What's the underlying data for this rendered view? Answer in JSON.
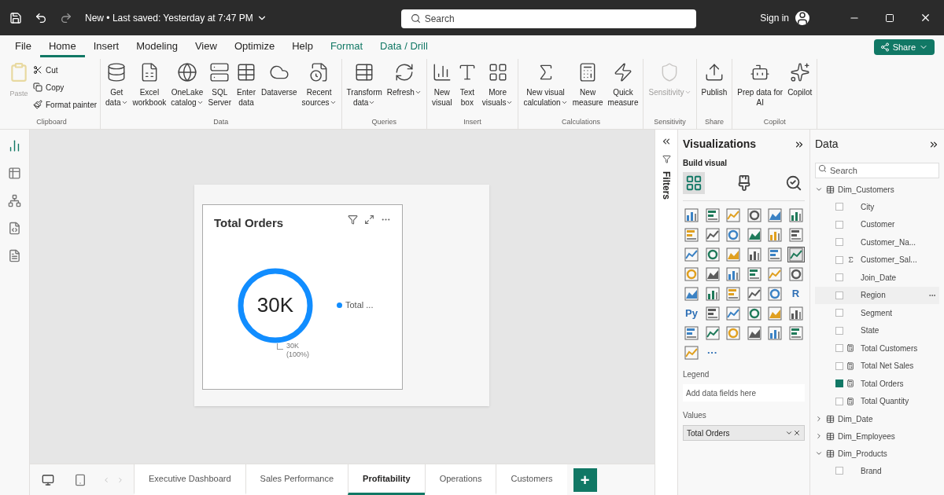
{
  "title_bar": {
    "title": "New • Last saved: Yesterday at 7:47 PM",
    "search": {
      "placeholder": "Search"
    },
    "sign_in": "Sign in"
  },
  "menu_tabs": [
    {
      "label": "File",
      "selected": false,
      "kind": "normal"
    },
    {
      "label": "Home",
      "selected": true,
      "kind": "normal"
    },
    {
      "label": "Insert",
      "selected": false,
      "kind": "normal"
    },
    {
      "label": "Modeling",
      "selected": false,
      "kind": "normal"
    },
    {
      "label": "View",
      "selected": false,
      "kind": "normal"
    },
    {
      "label": "Optimize",
      "selected": false,
      "kind": "normal"
    },
    {
      "label": "Help",
      "selected": false,
      "kind": "normal"
    },
    {
      "label": "Format",
      "selected": false,
      "kind": "contextual"
    },
    {
      "label": "Data / Drill",
      "selected": false,
      "kind": "contextual"
    }
  ],
  "share_button": "Share",
  "ribbon": [
    {
      "group": "Clipboard",
      "kind": "clipboard",
      "buttons": [
        {
          "lines": [
            "Paste"
          ],
          "disabled": true,
          "dropdown": false
        },
        {
          "lines": [
            "Cut"
          ],
          "disabled": false,
          "dropdown": false
        },
        {
          "lines": [
            "Copy"
          ],
          "disabled": false,
          "dropdown": false
        },
        {
          "lines": [
            "Format painter"
          ],
          "disabled": false,
          "dropdown": false
        }
      ]
    },
    {
      "group": "Data",
      "kind": "large",
      "buttons": [
        {
          "lines": [
            "Get",
            "data"
          ],
          "disabled": false,
          "dropdown": true
        },
        {
          "lines": [
            "Excel",
            "workbook"
          ],
          "disabled": false,
          "dropdown": false
        },
        {
          "lines": [
            "OneLake",
            "catalog"
          ],
          "disabled": false,
          "dropdown": true
        },
        {
          "lines": [
            "SQL",
            "Server"
          ],
          "disabled": false,
          "dropdown": false
        },
        {
          "lines": [
            "Enter",
            "data"
          ],
          "disabled": false,
          "dropdown": false
        },
        {
          "lines": [
            "Dataverse"
          ],
          "disabled": false,
          "dropdown": false
        },
        {
          "lines": [
            "Recent",
            "sources"
          ],
          "disabled": false,
          "dropdown": true
        }
      ]
    },
    {
      "group": "Queries",
      "kind": "large",
      "buttons": [
        {
          "lines": [
            "Transform",
            "data"
          ],
          "disabled": false,
          "dropdown": true
        },
        {
          "lines": [
            "Refresh"
          ],
          "disabled": false,
          "dropdown": true
        }
      ]
    },
    {
      "group": "Insert",
      "kind": "large",
      "buttons": [
        {
          "lines": [
            "New",
            "visual"
          ],
          "disabled": false,
          "dropdown": false
        },
        {
          "lines": [
            "Text",
            "box"
          ],
          "disabled": false,
          "dropdown": false
        },
        {
          "lines": [
            "More",
            "visuals"
          ],
          "disabled": false,
          "dropdown": true
        }
      ]
    },
    {
      "group": "Calculations",
      "kind": "large",
      "buttons": [
        {
          "lines": [
            "New visual",
            "calculation"
          ],
          "disabled": false,
          "dropdown": true
        },
        {
          "lines": [
            "New",
            "measure"
          ],
          "disabled": false,
          "dropdown": false
        },
        {
          "lines": [
            "Quick",
            "measure"
          ],
          "disabled": false,
          "dropdown": false
        }
      ]
    },
    {
      "group": "Sensitivity",
      "kind": "large",
      "buttons": [
        {
          "lines": [
            "Sensitivity"
          ],
          "disabled": true,
          "dropdown": true
        }
      ]
    },
    {
      "group": "Share",
      "kind": "large",
      "buttons": [
        {
          "lines": [
            "Publish"
          ],
          "disabled": false,
          "dropdown": false
        }
      ]
    },
    {
      "group": "Copilot",
      "kind": "large",
      "buttons": [
        {
          "lines": [
            "Prep data for",
            "AI"
          ],
          "disabled": false,
          "dropdown": false
        },
        {
          "lines": [
            "Copilot"
          ],
          "disabled": false,
          "dropdown": false
        }
      ]
    }
  ],
  "left_rail": [
    {
      "selected": true
    },
    {
      "selected": false
    },
    {
      "selected": false
    },
    {
      "selected": false
    },
    {
      "selected": false
    }
  ],
  "visual": {
    "title": "Total Orders",
    "center_value": "30K",
    "data_label": "30K",
    "data_label_share": "(100%)",
    "legend": [
      {
        "label": "Total ...",
        "color": "#118dff"
      }
    ]
  },
  "page_tabs": [
    {
      "label": "Executive Dashboard",
      "selected": false
    },
    {
      "label": "Sales Performance",
      "selected": false
    },
    {
      "label": "Profitability",
      "selected": true
    },
    {
      "label": "Operations",
      "selected": false
    },
    {
      "label": "Customers",
      "selected": false
    }
  ],
  "add_page": "+",
  "filters": {
    "title": "Filters"
  },
  "visualizations": {
    "title": "Visualizations",
    "subtitle": "Build visual",
    "build_tabs": [
      {
        "selected": true
      },
      {
        "selected": false
      },
      {
        "selected": false
      }
    ],
    "gallery": [
      {
        "kind": "icon",
        "selected": false
      },
      {
        "kind": "icon",
        "selected": false
      },
      {
        "kind": "icon",
        "selected": false
      },
      {
        "kind": "icon",
        "selected": false
      },
      {
        "kind": "icon",
        "selected": false
      },
      {
        "kind": "icon",
        "selected": false
      },
      {
        "kind": "icon",
        "selected": false
      },
      {
        "kind": "icon",
        "selected": false
      },
      {
        "kind": "icon",
        "selected": false
      },
      {
        "kind": "icon",
        "selected": false
      },
      {
        "kind": "icon",
        "selected": false
      },
      {
        "kind": "icon",
        "selected": false
      },
      {
        "kind": "icon",
        "selected": false
      },
      {
        "kind": "icon",
        "selected": false
      },
      {
        "kind": "icon",
        "selected": false
      },
      {
        "kind": "icon",
        "selected": false
      },
      {
        "kind": "icon",
        "selected": false
      },
      {
        "kind": "icon",
        "selected": true
      },
      {
        "kind": "icon",
        "selected": false
      },
      {
        "kind": "icon",
        "selected": false
      },
      {
        "kind": "icon",
        "selected": false
      },
      {
        "kind": "icon",
        "selected": false
      },
      {
        "kind": "icon",
        "selected": false
      },
      {
        "kind": "icon",
        "selected": false
      },
      {
        "kind": "icon",
        "selected": false
      },
      {
        "kind": "icon",
        "selected": false
      },
      {
        "kind": "icon",
        "selected": false
      },
      {
        "kind": "icon",
        "selected": false
      },
      {
        "kind": "icon",
        "selected": false
      },
      {
        "kind": "text",
        "text": "R",
        "selected": false
      },
      {
        "kind": "text",
        "text": "Py",
        "selected": false
      },
      {
        "kind": "icon",
        "selected": false
      },
      {
        "kind": "icon",
        "selected": false
      },
      {
        "kind": "icon",
        "selected": false
      },
      {
        "kind": "icon",
        "selected": false
      },
      {
        "kind": "icon",
        "selected": false
      },
      {
        "kind": "icon",
        "selected": false
      },
      {
        "kind": "icon",
        "selected": false
      },
      {
        "kind": "icon",
        "selected": false
      },
      {
        "kind": "icon",
        "selected": false
      },
      {
        "kind": "icon",
        "selected": false
      },
      {
        "kind": "icon",
        "selected": false
      },
      {
        "kind": "icon",
        "selected": false
      },
      {
        "kind": "text",
        "text": "···",
        "selected": false
      }
    ],
    "wells": [
      {
        "label": "Legend",
        "placeholder": "Add data fields here"
      },
      {
        "label": "Values",
        "value": "Total Orders"
      }
    ]
  },
  "data": {
    "title": "Data",
    "search": {
      "placeholder": "Search"
    },
    "tables": [
      {
        "name": "Dim_Customers",
        "expanded": true,
        "children": [
          {
            "label": "City",
            "kind": "column",
            "checked": false,
            "hovered": false
          },
          {
            "label": "Customer",
            "kind": "column",
            "checked": false,
            "hovered": false
          },
          {
            "label": "Customer_Na...",
            "kind": "column",
            "checked": false,
            "hovered": false
          },
          {
            "label": "Customer_Sal...",
            "kind": "sum",
            "checked": false,
            "hovered": false
          },
          {
            "label": "Join_Date",
            "kind": "column",
            "checked": false,
            "hovered": false
          },
          {
            "label": "Region",
            "kind": "column",
            "checked": false,
            "hovered": true
          },
          {
            "label": "Segment",
            "kind": "column",
            "checked": false,
            "hovered": false
          },
          {
            "label": "State",
            "kind": "column",
            "checked": false,
            "hovered": false
          },
          {
            "label": "Total Customers",
            "kind": "measure",
            "checked": false,
            "hovered": false
          },
          {
            "label": "Total Net Sales",
            "kind": "measure",
            "checked": false,
            "hovered": false
          },
          {
            "label": "Total Orders",
            "kind": "measure",
            "checked": true,
            "hovered": false
          },
          {
            "label": "Total Quantity",
            "kind": "measure",
            "checked": false,
            "hovered": false
          }
        ]
      },
      {
        "name": "Dim_Date",
        "expanded": false
      },
      {
        "name": "Dim_Employees",
        "expanded": false
      },
      {
        "name": "Dim_Products",
        "expanded": true,
        "children": [
          {
            "label": "Brand",
            "kind": "column",
            "checked": false,
            "hovered": false
          }
        ]
      }
    ]
  }
}
